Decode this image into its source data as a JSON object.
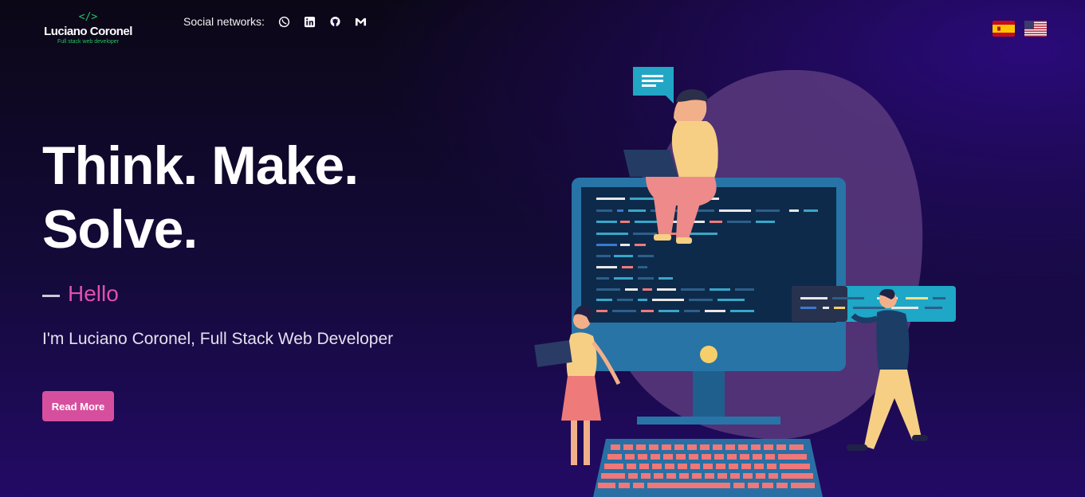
{
  "brand": {
    "code_icon": "</>",
    "name": "Luciano Coronel",
    "tagline": "Full stack web developer"
  },
  "social": {
    "label": "Social networks:",
    "icons": [
      "whatsapp-icon",
      "linkedin-icon",
      "github-icon",
      "gmail-icon"
    ]
  },
  "languages": [
    "spanish-flag",
    "us-flag"
  ],
  "hero": {
    "title": "Think. Make. Solve.",
    "hello": "Hello",
    "intro": "I'm Luciano Coronel, Full Stack Web Developer",
    "button": "Read More"
  },
  "colors": {
    "accent": "#d64f9e",
    "brand_green": "#22c55e",
    "background_top": "#0b0716",
    "background_bottom": "#230a66"
  }
}
